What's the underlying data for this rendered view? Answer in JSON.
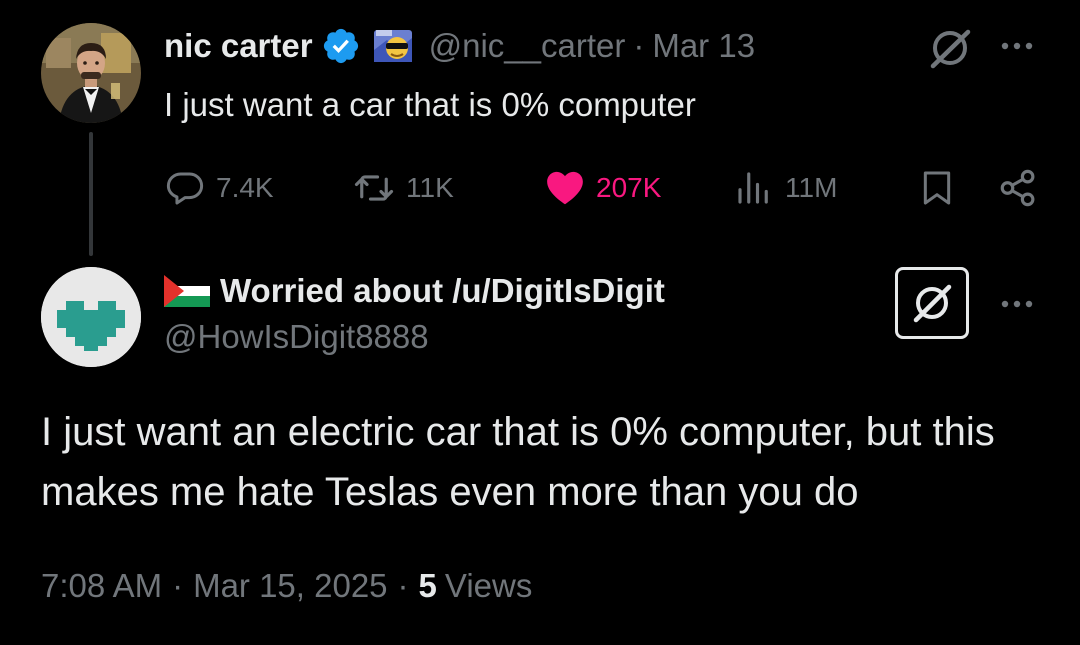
{
  "colors": {
    "background": "#000000",
    "primary_text": "#e7e9ea",
    "secondary_text": "#71767b",
    "like_pink": "#f91880",
    "verified_blue": "#1d9bf0"
  },
  "parent_tweet": {
    "display_name": "nic carter",
    "handle": "@nic__carter",
    "separator": "·",
    "date": "Mar 13",
    "text": "I just want a car that is 0% computer",
    "icons": [
      "verified-icon",
      "sunglasses-emoji-icon",
      "grok-icon",
      "more-icon"
    ],
    "actions": {
      "replies": "7.4K",
      "reposts": "11K",
      "likes": "207K",
      "views": "11M"
    }
  },
  "reply_tweet": {
    "display_name": "Worried about /u/DigitIsDigit",
    "handle": "@HowIsDigit8888",
    "text": "I just want an electric car that is 0% computer, but this makes me hate Teslas even more than you do",
    "time": "7:08 AM",
    "separator": "·",
    "date": "Mar 15, 2025",
    "views_count": "5",
    "views_label": "Views",
    "icons": [
      "palestine-flag-icon",
      "grok-icon",
      "more-icon"
    ]
  }
}
